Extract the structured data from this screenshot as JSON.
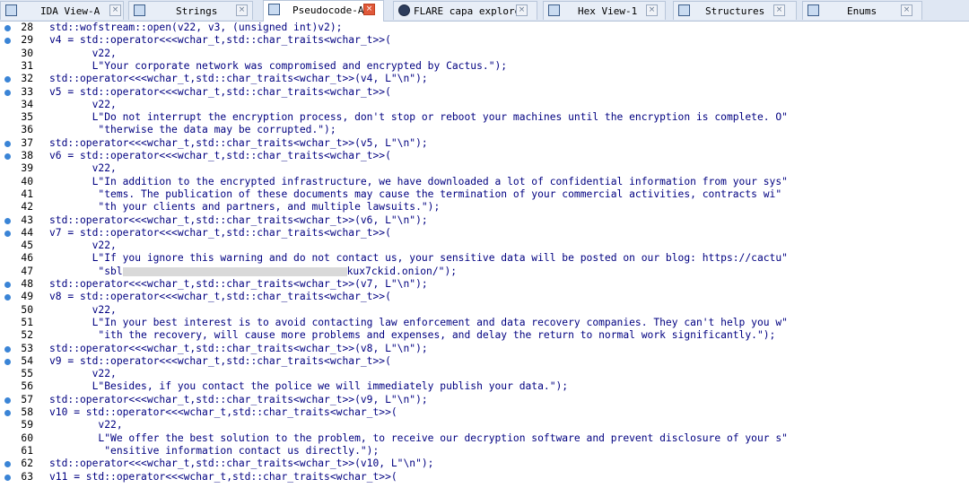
{
  "tabs": [
    {
      "label": "IDA View-A",
      "icon": "ida-view-icon",
      "active": false
    },
    {
      "label": "Strings",
      "icon": "strings-icon",
      "active": false
    },
    {
      "label": "Pseudocode-A",
      "icon": "pseudocode-icon",
      "active": true
    },
    {
      "label": "FLARE capa explorer",
      "icon": "capa-icon",
      "active": false
    },
    {
      "label": "Hex View-1",
      "icon": "hex-icon",
      "active": false
    },
    {
      "label": "Structures",
      "icon": "structures-icon",
      "active": false
    },
    {
      "label": "Enums",
      "icon": "enums-icon",
      "active": false
    }
  ],
  "code_lines": [
    {
      "num": "28",
      "text": "std::wofstream::open(v22, v3, (unsigned int)v2);",
      "bp": true
    },
    {
      "num": "29",
      "text": "v4 = std::operator<<<wchar_t,std::char_traits<wchar_t>>(",
      "bp": true
    },
    {
      "num": "30",
      "text": "       v22,",
      "bp": false
    },
    {
      "num": "31",
      "text": "       L\"Your corporate network was compromised and encrypted by Cactus.\");",
      "bp": false
    },
    {
      "num": "32",
      "text": "std::operator<<<wchar_t,std::char_traits<wchar_t>>(v4, L\"\\n\");",
      "bp": true
    },
    {
      "num": "33",
      "text": "v5 = std::operator<<<wchar_t,std::char_traits<wchar_t>>(",
      "bp": true
    },
    {
      "num": "34",
      "text": "       v22,",
      "bp": false
    },
    {
      "num": "35",
      "text": "       L\"Do not interrupt the encryption process, don't stop or reboot your machines until the encryption is complete. O\"",
      "bp": false
    },
    {
      "num": "36",
      "text": "        \"therwise the data may be corrupted.\");",
      "bp": false
    },
    {
      "num": "37",
      "text": "std::operator<<<wchar_t,std::char_traits<wchar_t>>(v5, L\"\\n\");",
      "bp": true
    },
    {
      "num": "38",
      "text": "v6 = std::operator<<<wchar_t,std::char_traits<wchar_t>>(",
      "bp": true
    },
    {
      "num": "39",
      "text": "       v22,",
      "bp": false
    },
    {
      "num": "40",
      "text": "       L\"In addition to the encrypted infrastructure, we have downloaded a lot of confidential information from your sys\"",
      "bp": false
    },
    {
      "num": "41",
      "text": "        \"tems. The publication of these documents may cause the termination of your commercial activities, contracts wi\"",
      "bp": false
    },
    {
      "num": "42",
      "text": "        \"th your clients and partners, and multiple lawsuits.\");",
      "bp": false
    },
    {
      "num": "43",
      "text": "std::operator<<<wchar_t,std::char_traits<wchar_t>>(v6, L\"\\n\");",
      "bp": true
    },
    {
      "num": "44",
      "text": "v7 = std::operator<<<wchar_t,std::char_traits<wchar_t>>(",
      "bp": true
    },
    {
      "num": "45",
      "text": "       v22,",
      "bp": false
    },
    {
      "num": "46",
      "text": "       L\"If you ignore this warning and do not contact us, your sensitive data will be posted on our blog: https://cactu\"",
      "bp": false
    },
    {
      "num": "47",
      "text": "        \"sbl",
      "text2": "kux7ckid.onion/\");",
      "redacted": true,
      "bp": false
    },
    {
      "num": "48",
      "text": "std::operator<<<wchar_t,std::char_traits<wchar_t>>(v7, L\"\\n\");",
      "bp": true
    },
    {
      "num": "49",
      "text": "v8 = std::operator<<<wchar_t,std::char_traits<wchar_t>>(",
      "bp": true
    },
    {
      "num": "50",
      "text": "       v22,",
      "bp": false
    },
    {
      "num": "51",
      "text": "       L\"In your best interest is to avoid contacting law enforcement and data recovery companies. They can't help you w\"",
      "bp": false
    },
    {
      "num": "52",
      "text": "        \"ith the recovery, will cause more problems and expenses, and delay the return to normal work significantly.\");",
      "bp": false
    },
    {
      "num": "53",
      "text": "std::operator<<<wchar_t,std::char_traits<wchar_t>>(v8, L\"\\n\");",
      "bp": true
    },
    {
      "num": "54",
      "text": "v9 = std::operator<<<wchar_t,std::char_traits<wchar_t>>(",
      "bp": true
    },
    {
      "num": "55",
      "text": "       v22,",
      "bp": false
    },
    {
      "num": "56",
      "text": "       L\"Besides, if you contact the police we will immediately publish your data.\");",
      "bp": false
    },
    {
      "num": "57",
      "text": "std::operator<<<wchar_t,std::char_traits<wchar_t>>(v9, L\"\\n\");",
      "bp": true
    },
    {
      "num": "58",
      "text": "v10 = std::operator<<<wchar_t,std::char_traits<wchar_t>>(",
      "bp": true
    },
    {
      "num": "59",
      "text": "        v22,",
      "bp": false
    },
    {
      "num": "60",
      "text": "        L\"We offer the best solution to the problem, to receive our decryption software and prevent disclosure of your s\"",
      "bp": false
    },
    {
      "num": "61",
      "text": "         \"ensitive information contact us directly.\");",
      "bp": false
    },
    {
      "num": "62",
      "text": "std::operator<<<wchar_t,std::char_traits<wchar_t>>(v10, L\"\\n\");",
      "bp": true
    },
    {
      "num": "63",
      "text": "v11 = std::operator<<<wchar_t,std::char_traits<wchar_t>>(",
      "bp": true
    }
  ]
}
